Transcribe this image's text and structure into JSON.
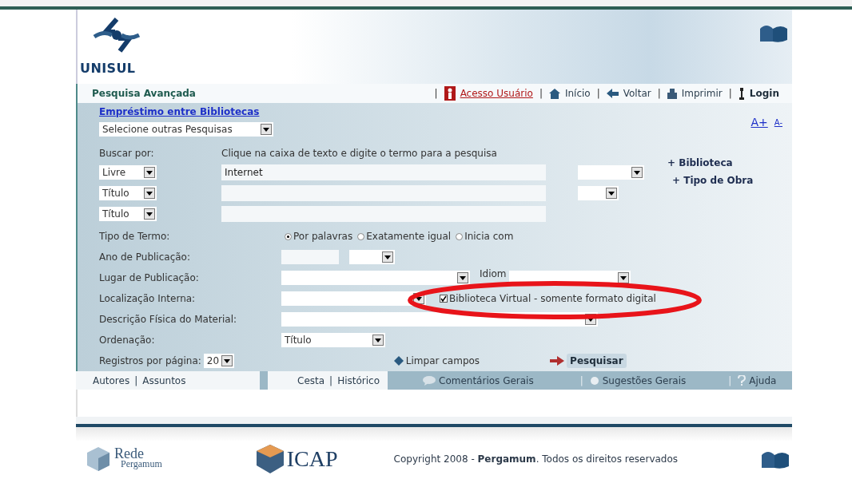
{
  "header": {
    "logo_text": "UNISUL"
  },
  "nav": {
    "title": "Pesquisa Avançada",
    "separator": "|",
    "links": [
      {
        "label": "Acesso Usuário",
        "kind": "user"
      },
      {
        "label": "Início",
        "kind": "home"
      },
      {
        "label": "Voltar",
        "kind": "back"
      },
      {
        "label": "Imprimir",
        "kind": "print"
      },
      {
        "label": "Login",
        "kind": "login"
      }
    ]
  },
  "form": {
    "loan_link": "Empréstimo entre Bibliotecas",
    "other_searches": "Selecione outras Pesquisas",
    "font_links": [
      "A+",
      "A-"
    ],
    "search_by_label": "Buscar por:",
    "hint": "Clique na caixa de texto e digite o termo para a pesquisa",
    "search_rows": [
      {
        "field": "Livre",
        "value": "Internet",
        "kind": "wide"
      },
      {
        "field": "Título",
        "value": "",
        "kind": "narrow"
      },
      {
        "field": "Título",
        "value": "",
        "kind": "plain"
      }
    ],
    "side_links": [
      "+ Biblioteca",
      "+ Tipo de Obra"
    ],
    "term_type_label": "Tipo de Termo:",
    "term_types": [
      {
        "label": "Por palavras",
        "selected": true
      },
      {
        "label": "Exatamente igual",
        "selected": false
      },
      {
        "label": "Inicia com",
        "selected": false
      }
    ],
    "year_label": "Ano de Publicação:",
    "place_label": "Lugar de Publicação:",
    "language_label": "Idiom",
    "location_label": "Localização Interna:",
    "virtual_library": {
      "label": "Biblioteca Virtual - somente formato digital",
      "checked": true
    },
    "physical_label": "Descrição Física do Material:",
    "order_label": "Ordenação:",
    "order_value": "Título",
    "per_page_label": "Registros por página:",
    "per_page_value": "20",
    "clear_button": "Limpar campos",
    "search_button": "Pesquisar"
  },
  "bottom_bar": {
    "separator": "|",
    "groups": [
      [
        "Autores",
        "Assuntos"
      ],
      [
        "Cesta",
        "Histórico"
      ]
    ],
    "items": [
      {
        "label": "Comentários Gerais",
        "kind": "comments"
      },
      {
        "label": "Sugestões Gerais",
        "kind": "suggestions"
      },
      {
        "label": "Ajuda",
        "kind": "help"
      }
    ]
  },
  "footer": {
    "rede": [
      "Rede",
      "Pergamum"
    ],
    "icap": "ICAP",
    "copyright": "Copyright 2008 - **Pergamum**. Todos os direitos reservados"
  }
}
